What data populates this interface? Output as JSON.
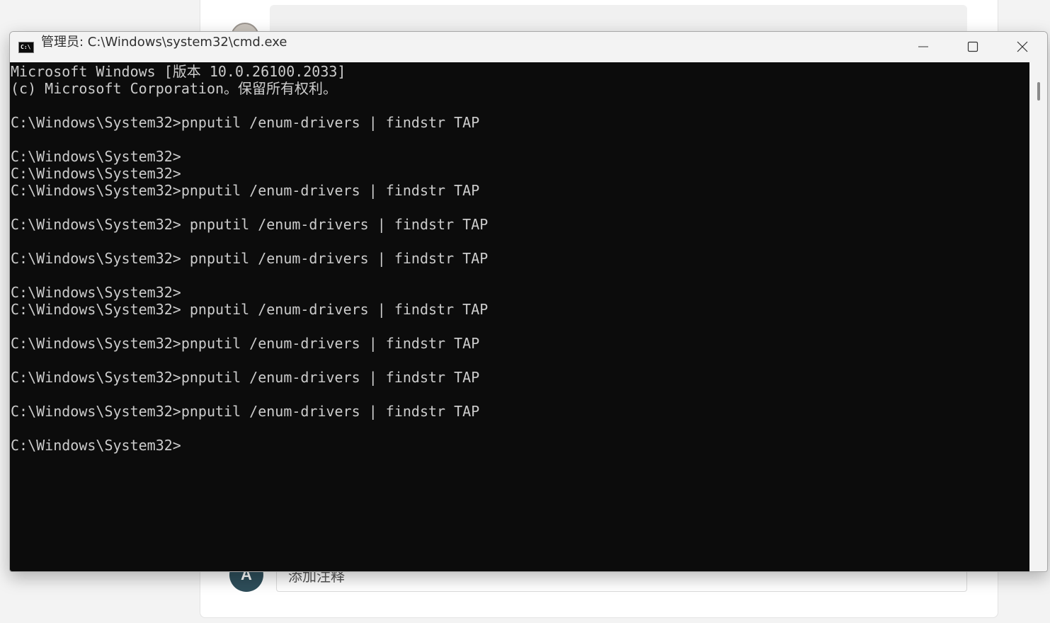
{
  "background": {
    "comment_avatar_letter": "A",
    "comment_placeholder": "添加注释"
  },
  "window": {
    "title": "管理员: C:\\Windows\\system32\\cmd.exe",
    "icon": "cmd-app-icon",
    "controls": {
      "minimize_icon": "minimize-icon",
      "maximize_icon": "maximize-icon",
      "close_icon": "close-icon"
    }
  },
  "console": {
    "lines": [
      "Microsoft Windows [版本 10.0.26100.2033]",
      "(c) Microsoft Corporation。保留所有权利。",
      "",
      "C:\\Windows\\System32>pnputil /enum-drivers | findstr TAP",
      "",
      "C:\\Windows\\System32>",
      "C:\\Windows\\System32>",
      "C:\\Windows\\System32>pnputil /enum-drivers | findstr TAP",
      "",
      "C:\\Windows\\System32> pnputil /enum-drivers | findstr TAP",
      "",
      "C:\\Windows\\System32> pnputil /enum-drivers | findstr TAP",
      "",
      "C:\\Windows\\System32>",
      "C:\\Windows\\System32> pnputil /enum-drivers | findstr TAP",
      "",
      "C:\\Windows\\System32>pnputil /enum-drivers | findstr TAP",
      "",
      "C:\\Windows\\System32>pnputil /enum-drivers | findstr TAP",
      "",
      "C:\\Windows\\System32>pnputil /enum-drivers | findstr TAP",
      "",
      "C:\\Windows\\System32>"
    ]
  },
  "colors": {
    "console_bg": "#0c0c0c",
    "console_fg": "#cccccc",
    "titlebar_bg": "#f3f3f3"
  }
}
